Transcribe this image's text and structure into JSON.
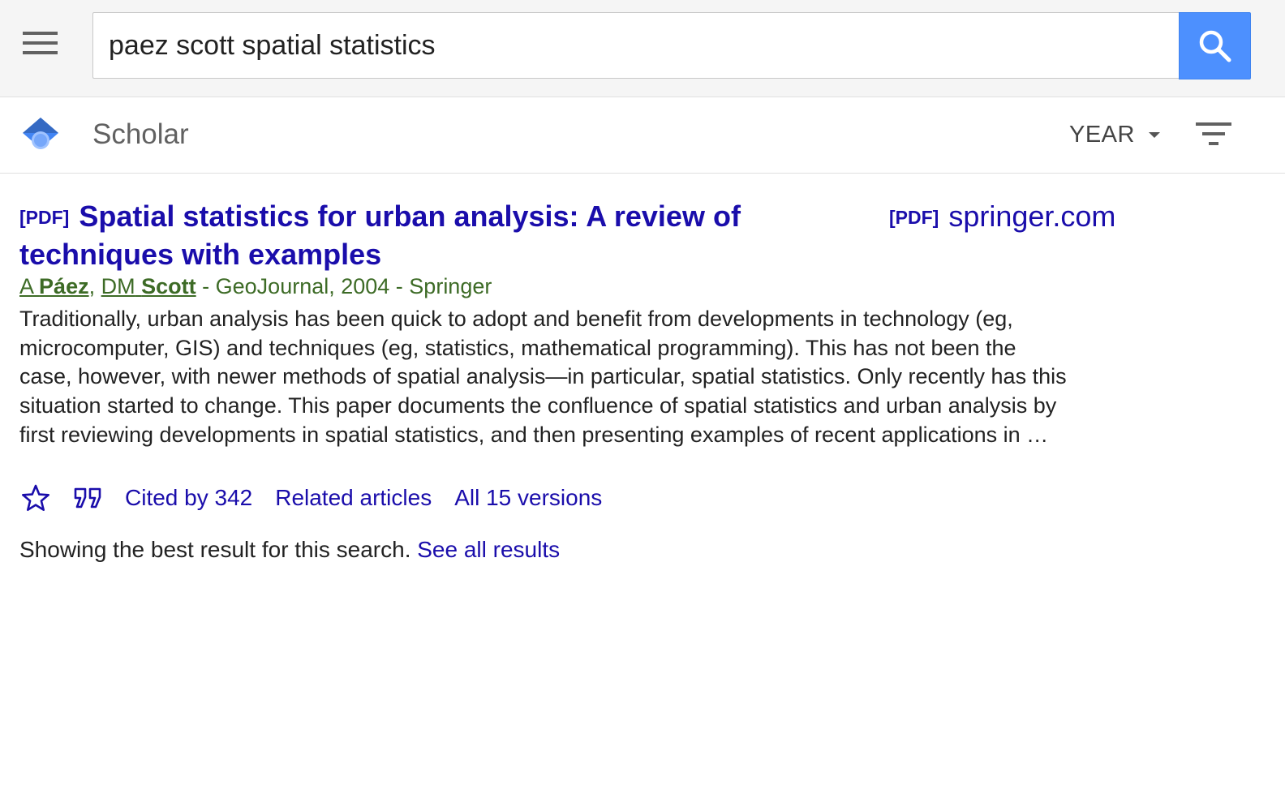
{
  "search": {
    "query": "paez scott spatial statistics",
    "menu_icon": "hamburger-menu-icon",
    "search_icon": "search-icon",
    "accent_color": "#4d90fe"
  },
  "header": {
    "logo_icon": "scholar-logo-icon",
    "title": "Scholar",
    "year_filter_label": "YEAR",
    "year_caret_icon": "caret-down-icon",
    "filter_icon": "filter-icon"
  },
  "result": {
    "pdf_tag": "[PDF]",
    "title_bold": "Spatial statistics",
    "title_rest": " for urban analysis: A review of techniques with examples",
    "side_link_tag": "[PDF]",
    "side_link_domain": "springer.com",
    "authors": [
      {
        "initials": "A",
        "surname": "Páez"
      },
      {
        "initials": "DM",
        "surname": "Scott"
      }
    ],
    "author_separator": ",",
    "dash": " - ",
    "journal_year": "GeoJournal, 2004",
    "publisher": "Springer",
    "snippet": "Traditionally, urban analysis has been quick to adopt and benefit from developments in technology (eg, microcomputer, GIS) and techniques (eg, statistics, mathematical programming). This has not been the case, however, with newer methods of spatial analysis—in particular, spatial statistics. Only recently has this situation started to change. This paper documents the confluence of spatial statistics and urban analysis by first reviewing developments in spatial statistics, and then presenting examples of recent applications in …",
    "actions": {
      "save_icon": "star-icon",
      "cite_icon": "quote-icon",
      "cited_by": "Cited by 342",
      "related": "Related articles",
      "versions": "All 15 versions"
    },
    "link_color": "#1a0dab",
    "author_color": "#3d6b26"
  },
  "footer": {
    "note": "Showing the best result for this search.",
    "see_all": "See all results"
  }
}
